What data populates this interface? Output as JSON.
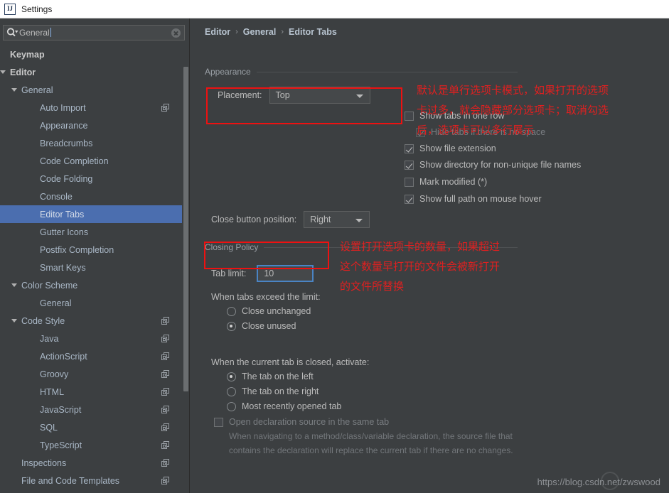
{
  "window": {
    "title": "Settings",
    "app_icon": "intellij-idea-icon"
  },
  "sidebar": {
    "search": {
      "value": "General",
      "icon": "search-icon",
      "clear_icon": "clear-icon"
    },
    "items": [
      {
        "label": "Keymap",
        "indent": 14,
        "arrow": false,
        "bold": true,
        "copy": false,
        "selected": false
      },
      {
        "label": "Editor",
        "indent": 14,
        "arrow": true,
        "bold": true,
        "copy": false,
        "selected": false
      },
      {
        "label": "General",
        "indent": 30,
        "arrow": true,
        "bold": false,
        "copy": false,
        "selected": false
      },
      {
        "label": "Auto Import",
        "indent": 56,
        "arrow": false,
        "bold": false,
        "copy": true,
        "selected": false
      },
      {
        "label": "Appearance",
        "indent": 56,
        "arrow": false,
        "bold": false,
        "copy": false,
        "selected": false
      },
      {
        "label": "Breadcrumbs",
        "indent": 56,
        "arrow": false,
        "bold": false,
        "copy": false,
        "selected": false
      },
      {
        "label": "Code Completion",
        "indent": 56,
        "arrow": false,
        "bold": false,
        "copy": false,
        "selected": false
      },
      {
        "label": "Code Folding",
        "indent": 56,
        "arrow": false,
        "bold": false,
        "copy": false,
        "selected": false
      },
      {
        "label": "Console",
        "indent": 56,
        "arrow": false,
        "bold": false,
        "copy": false,
        "selected": false
      },
      {
        "label": "Editor Tabs",
        "indent": 56,
        "arrow": false,
        "bold": false,
        "copy": false,
        "selected": true
      },
      {
        "label": "Gutter Icons",
        "indent": 56,
        "arrow": false,
        "bold": false,
        "copy": false,
        "selected": false
      },
      {
        "label": "Postfix Completion",
        "indent": 56,
        "arrow": false,
        "bold": false,
        "copy": false,
        "selected": false
      },
      {
        "label": "Smart Keys",
        "indent": 56,
        "arrow": false,
        "bold": false,
        "copy": false,
        "selected": false
      },
      {
        "label": "Color Scheme",
        "indent": 30,
        "arrow": true,
        "bold": false,
        "copy": false,
        "selected": false
      },
      {
        "label": "General",
        "indent": 56,
        "arrow": false,
        "bold": false,
        "copy": false,
        "selected": false
      },
      {
        "label": "Code Style",
        "indent": 30,
        "arrow": true,
        "bold": false,
        "copy": true,
        "selected": false
      },
      {
        "label": "Java",
        "indent": 56,
        "arrow": false,
        "bold": false,
        "copy": true,
        "selected": false
      },
      {
        "label": "ActionScript",
        "indent": 56,
        "arrow": false,
        "bold": false,
        "copy": true,
        "selected": false
      },
      {
        "label": "Groovy",
        "indent": 56,
        "arrow": false,
        "bold": false,
        "copy": true,
        "selected": false
      },
      {
        "label": "HTML",
        "indent": 56,
        "arrow": false,
        "bold": false,
        "copy": true,
        "selected": false
      },
      {
        "label": "JavaScript",
        "indent": 56,
        "arrow": false,
        "bold": false,
        "copy": true,
        "selected": false
      },
      {
        "label": "SQL",
        "indent": 56,
        "arrow": false,
        "bold": false,
        "copy": true,
        "selected": false
      },
      {
        "label": "TypeScript",
        "indent": 56,
        "arrow": false,
        "bold": false,
        "copy": true,
        "selected": false
      },
      {
        "label": "Inspections",
        "indent": 30,
        "arrow": false,
        "bold": false,
        "copy": true,
        "selected": false
      },
      {
        "label": "File and Code Templates",
        "indent": 30,
        "arrow": false,
        "bold": false,
        "copy": true,
        "selected": false
      }
    ]
  },
  "main": {
    "breadcrumb": {
      "item1": "Editor",
      "item2": "General",
      "item3": "Editor Tabs",
      "separator": "›"
    },
    "appearance": {
      "group_title": "Appearance",
      "placement_label": "Placement:",
      "placement_value": "Top",
      "checkboxes": [
        {
          "label": "Show tabs in one row",
          "checked": false,
          "disabled": false
        },
        {
          "label": "Hide tabs if there is no space",
          "checked": true,
          "disabled": true
        },
        {
          "label": "Show file extension",
          "checked": true,
          "disabled": false
        },
        {
          "label": "Show directory for non-unique file names",
          "checked": true,
          "disabled": false
        },
        {
          "label": "Mark modified (*)",
          "checked": false,
          "disabled": false
        },
        {
          "label": "Show full path on mouse hover",
          "checked": true,
          "disabled": false
        }
      ],
      "close_button_label": "Close button position:",
      "close_button_value": "Right"
    },
    "closing_policy": {
      "group_title": "Closing Policy",
      "tab_limit_label": "Tab limit:",
      "tab_limit_value": "10",
      "exceed_label": "When tabs exceed the limit:",
      "exceed_options": [
        {
          "label": "Close unchanged",
          "selected": false
        },
        {
          "label": "Close unused",
          "selected": true
        }
      ],
      "activate_label": "When the current tab is closed, activate:",
      "activate_options": [
        {
          "label": "The tab on the left",
          "selected": true
        },
        {
          "label": "The tab on the right",
          "selected": false
        },
        {
          "label": "Most recently opened tab",
          "selected": false
        }
      ],
      "open_decl_label": "Open declaration source in the same tab",
      "open_decl_checked": false,
      "open_decl_desc": "When navigating to a method/class/variable declaration, the source file that contains the declaration will replace the current tab if there are no changes."
    }
  },
  "annotations": [
    {
      "text": "默认是单行选项卡模式，如果打开的选项\n卡过多，就会隐藏部分选项卡；取消勾选\n后，选项卡可以多行展示"
    },
    {
      "text": "设置打开选项卡的数量，如果超过\n这个数量早打开的文件会被新打开\n的文件所替换"
    }
  ],
  "watermark": {
    "text": "https://blog.csdn.net/zwswood"
  },
  "colors": {
    "background": "#3c3f41",
    "selection": "#4b6eaf",
    "annotation_red": "#e02020",
    "box_red": "#ee1111",
    "focus_blue": "#4a84c4"
  }
}
